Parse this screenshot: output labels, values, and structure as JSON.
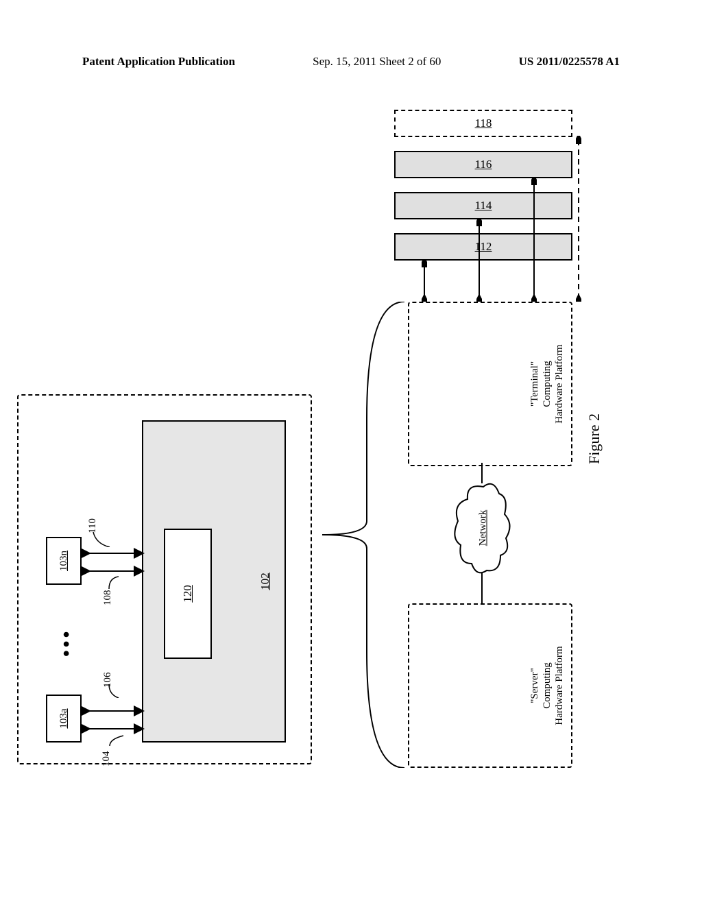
{
  "header": {
    "left": "Patent Application Publication",
    "center": "Sep. 15, 2011  Sheet 2 of 60",
    "right": "US 2011/0225578 A1"
  },
  "figure": {
    "label": "Figure 2"
  },
  "upper": {
    "box103a": "103a",
    "box103n": "103n",
    "dots": "•••",
    "ref104": "104",
    "ref106": "106",
    "ref108": "108",
    "ref110": "110",
    "block102": "102",
    "block120": "120"
  },
  "lower": {
    "server_label": "\"Server\" Computing\nHardware Platform",
    "terminal_label": "\"Terminal\" Computing\nHardware Platform",
    "cloud_label": "Network"
  },
  "slabs": {
    "s1": "112",
    "s2": "114",
    "s3": "116",
    "s4": "118"
  }
}
